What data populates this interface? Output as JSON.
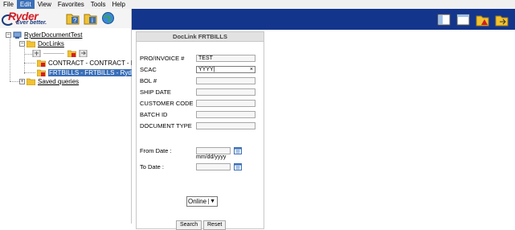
{
  "menu": [
    "File",
    "Edit",
    "View",
    "Favorites",
    "Tools",
    "Help"
  ],
  "logo": {
    "name": "Ryder",
    "tagline": "Ever better."
  },
  "tree": {
    "root": "RyderDocumentTest",
    "doclinks": "DocLinks",
    "item1": "CONTRACT - CONTRACT - Ry",
    "item2": "FRTBILLS - FRTBILLS - Ryde",
    "saved": "Saved queries"
  },
  "form": {
    "title": "DocLink   FRTBILLS",
    "fields": [
      {
        "label": "PRO/INVOICE #",
        "value": "TEST"
      },
      {
        "label": "SCAC",
        "value": "YYYY|",
        "clear": "×"
      },
      {
        "label": "BOL #",
        "value": ""
      },
      {
        "label": "SHIP DATE",
        "value": ""
      },
      {
        "label": "CUSTOMER CODE",
        "value": ""
      },
      {
        "label": "BATCH ID",
        "value": ""
      },
      {
        "label": "DOCUMENT TYPE",
        "value": ""
      }
    ],
    "from_label": "From Date :",
    "to_label": "To Date :",
    "date_hint": "mm/dd/yyyy",
    "mode": "Online",
    "search": "Search",
    "reset": "Reset"
  },
  "colors": {
    "topbar": "#13358c",
    "selection": "#3a6fb8",
    "logo_red": "#d31f27"
  }
}
